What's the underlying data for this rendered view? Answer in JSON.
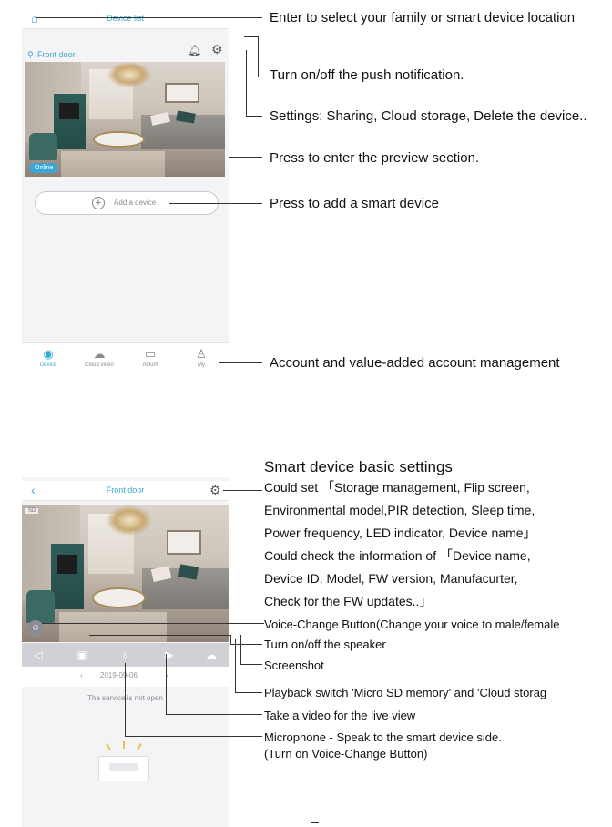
{
  "screen1": {
    "header_title": "Device list",
    "device_name": "Front door",
    "status_badge": "Online",
    "add_device_label": "Add a device",
    "tabs": [
      "Device",
      "Cloud video",
      "Album",
      "My"
    ]
  },
  "screen2": {
    "header_title": "Front door",
    "quality_badge": "SD",
    "date": "2019-09-06",
    "service_message": "The service is not open"
  },
  "annotations1": {
    "home": "Enter to select your family or smart device location",
    "push": "Turn on/off the push notification.",
    "settings": "Settings: Sharing, Cloud storage, Delete the device..",
    "preview": "Press to enter the preview section.",
    "add": "Press to add a smart device",
    "account": "Account and value-added account management"
  },
  "annotations2": {
    "title": "Smart device basic settings",
    "desc": [
      "Could set 「Storage management, Flip screen,",
      "Environmental model,PIR detection, Sleep time,",
      "Power frequency, LED indicator, Device name」",
      "Could check the information of 「Device name,",
      "Device ID, Model, FW version, Manufacurter,",
      "Check for the FW updates..」"
    ],
    "voice": "Voice-Change Button(Change your voice to male/female",
    "speaker": "Turn on/off the speaker",
    "screenshot": "Screenshot",
    "playback": "Playback  switch 'Micro SD memory' and 'Cloud storag",
    "video": "Take a video for the live view",
    "mic1": "Microphone - Speak to the smart device side.",
    "mic2": "(Turn on Voice-Change Button)"
  },
  "footer_mark": "_",
  "colors": {
    "accent": "#3aa7d5",
    "control_bar": "#cfd1d6",
    "line": "#333333"
  },
  "icons": [
    "home-icon",
    "location-pin-icon",
    "bell-icon",
    "gear-icon",
    "plus-icon",
    "camera-tab-icon",
    "cloud-video-icon",
    "album-icon",
    "user-icon",
    "back-arrow-icon",
    "speaker-mute-icon",
    "screenshot-icon",
    "microphone-icon",
    "record-video-icon",
    "cloud-playback-icon",
    "voice-change-icon",
    "empty-tray-icon"
  ]
}
